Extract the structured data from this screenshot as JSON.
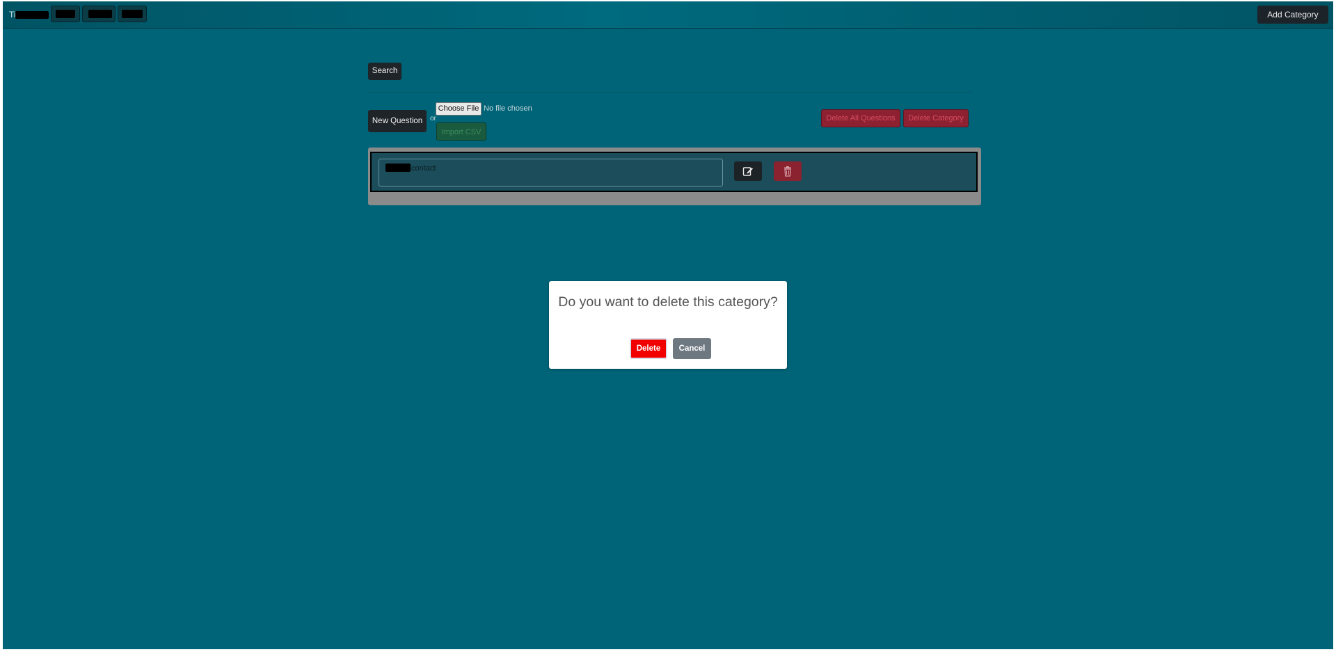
{
  "navbar": {
    "brand": "Ti",
    "nav_items": [
      "",
      "",
      ""
    ],
    "add_category_label": "Add Category"
  },
  "toolbar": {
    "search_label": "Search",
    "new_question_label": "New Question",
    "or_text": "or",
    "choose_file_label": "Choose File",
    "no_file_text": "No file chosen",
    "import_csv_label": "Import CSV",
    "delete_all_questions_label": "Delete All Questions",
    "delete_category_label": "Delete Category"
  },
  "questions": [
    {
      "text": "contact"
    }
  ],
  "modal": {
    "title": "Do you want to delete this category?",
    "delete_label": "Delete",
    "cancel_label": "Cancel"
  },
  "icons": {
    "edit": "edit-icon",
    "delete": "trash-icon"
  },
  "colors": {
    "page_bg": "#006478",
    "danger": "#f20000",
    "secondary": "#6e7881"
  }
}
